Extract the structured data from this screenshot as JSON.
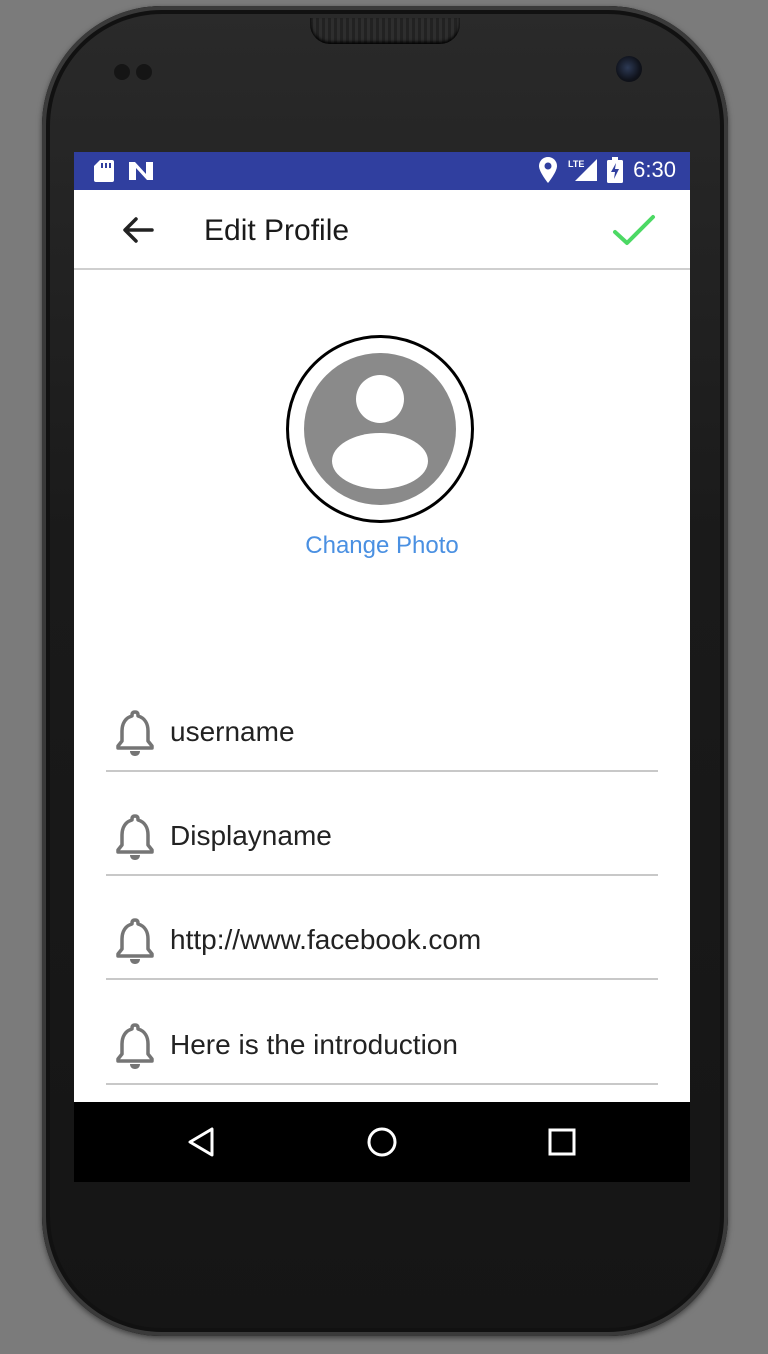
{
  "status_bar": {
    "time": "6:30",
    "network": "LTE",
    "icons": [
      "sd-card-icon",
      "n-notification-icon",
      "location-icon",
      "lte-signal-icon",
      "battery-charging-icon"
    ]
  },
  "toolbar": {
    "title": "Edit Profile",
    "back_icon": "arrow-back-icon",
    "confirm_icon": "check-icon"
  },
  "profile": {
    "change_photo_label": "Change Photo",
    "avatar_icon": "account-circle-icon"
  },
  "fields": [
    {
      "icon": "bell-icon",
      "value": "username"
    },
    {
      "icon": "bell-icon",
      "value": "Displayname"
    },
    {
      "icon": "bell-icon",
      "value": "http://www.facebook.com"
    },
    {
      "icon": "bell-icon",
      "value": "Here is the introduction"
    }
  ],
  "colors": {
    "status_bar": "#303f9f",
    "accent_link": "#4a90e2",
    "check": "#4cd964",
    "icon_gray": "#757575"
  }
}
